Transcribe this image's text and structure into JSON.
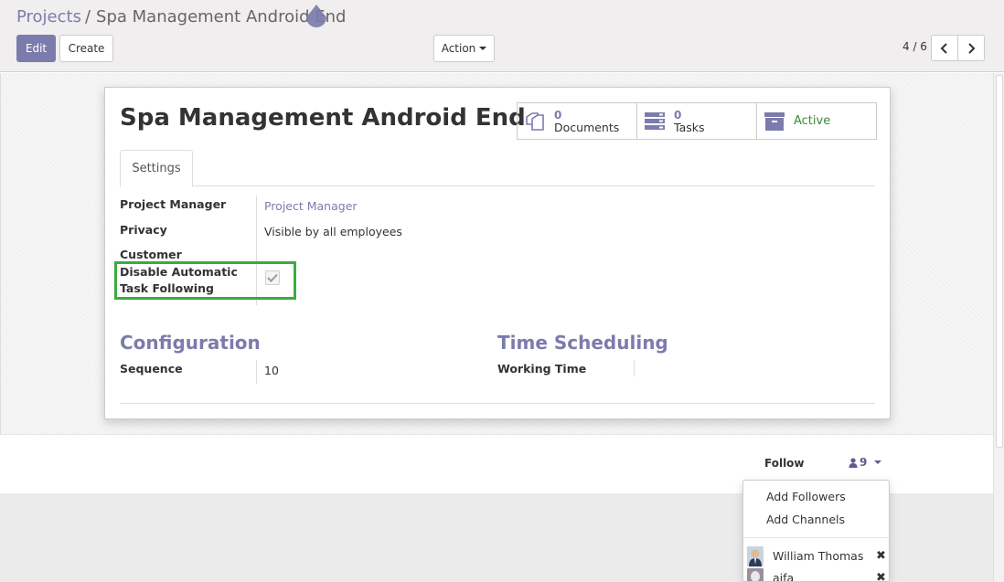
{
  "breadcrumb": {
    "parent": "Projects",
    "separator": "/",
    "current": "Spa Management Android End"
  },
  "toolbar": {
    "edit_label": "Edit",
    "create_label": "Create",
    "action_label": "Action"
  },
  "pager": {
    "value": "4 / 6",
    "prev_icon": "chevron-left-icon",
    "next_icon": "chevron-right-icon"
  },
  "record": {
    "title": "Spa Management Android End",
    "stats": [
      {
        "value": "0",
        "label": "Documents",
        "icon": "documents-icon"
      },
      {
        "value": "0",
        "label": "Tasks",
        "icon": "tasks-icon"
      },
      {
        "label": "Active",
        "icon": "archive-icon"
      }
    ],
    "tabs": [
      {
        "label": "Settings"
      }
    ],
    "fields": {
      "project_manager": {
        "label": "Project Manager",
        "value": "Project Manager"
      },
      "privacy": {
        "label": "Privacy",
        "value": "Visible by all employees"
      },
      "customer": {
        "label": "Customer",
        "value": ""
      },
      "disable_following": {
        "label_line1": "Disable Automatic",
        "label_line2": "Task Following",
        "checked": true
      }
    },
    "configuration": {
      "title": "Configuration",
      "sequence_label": "Sequence",
      "sequence_value": "10"
    },
    "time_scheduling": {
      "title": "Time Scheduling",
      "working_time_label": "Working Time",
      "working_time_value": ""
    }
  },
  "chatter": {
    "follow_label": "Follow",
    "followers_count": "9",
    "dropdown": {
      "add_followers": "Add Followers",
      "add_channels": "Add Channels",
      "followers": [
        {
          "name": "William Thomas"
        },
        {
          "name": "aifa"
        }
      ]
    }
  },
  "colors": {
    "brand": "#7c7bad",
    "highlight": "#3bab3f",
    "active": "#3a8a3a"
  }
}
